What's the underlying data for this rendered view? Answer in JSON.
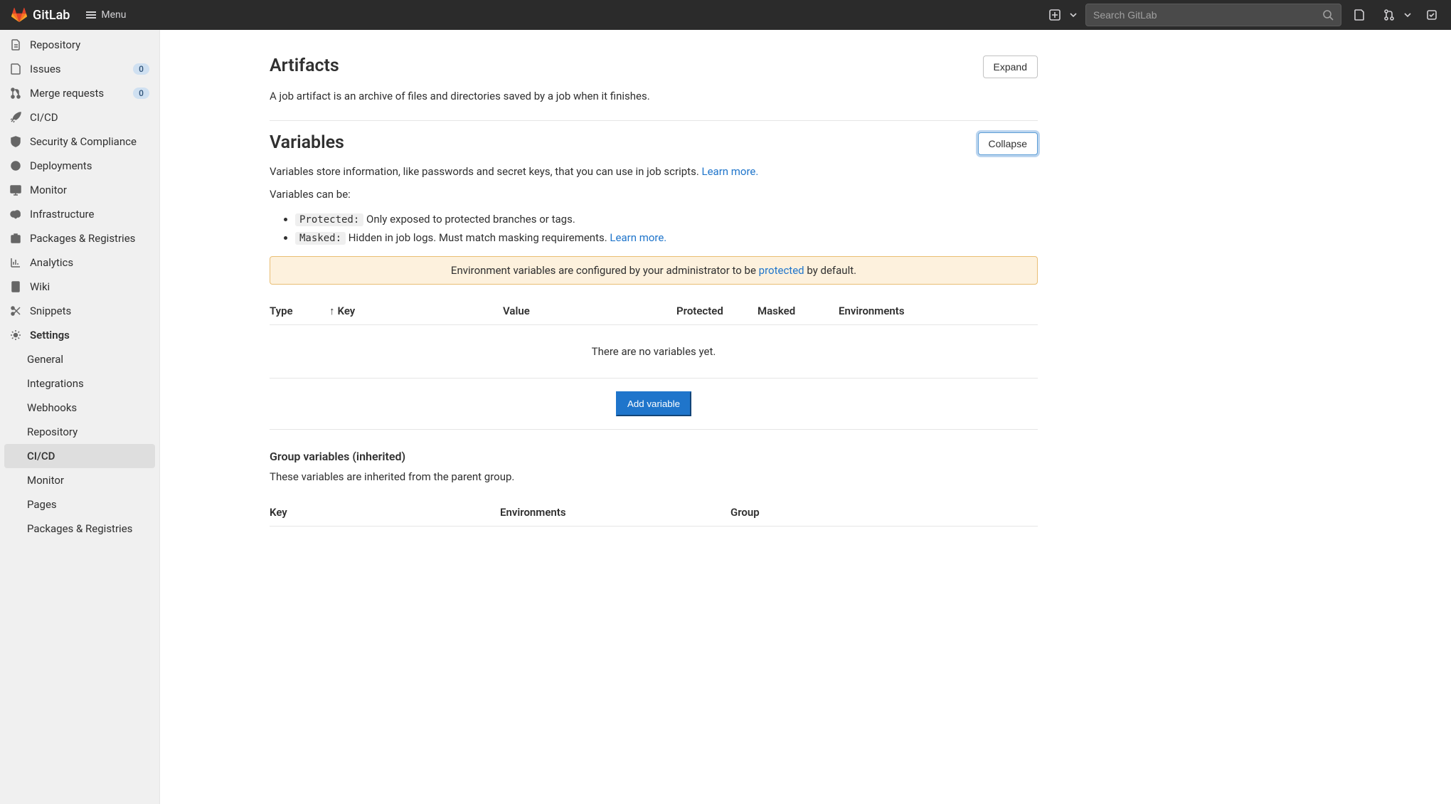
{
  "header": {
    "brand": "GitLab",
    "menu_label": "Menu",
    "search_placeholder": "Search GitLab"
  },
  "sidebar": {
    "items": [
      {
        "label": "Repository",
        "icon": "doc"
      },
      {
        "label": "Issues",
        "icon": "issues",
        "badge": "0"
      },
      {
        "label": "Merge requests",
        "icon": "merge",
        "badge": "0"
      },
      {
        "label": "CI/CD",
        "icon": "rocket"
      },
      {
        "label": "Security & Compliance",
        "icon": "shield"
      },
      {
        "label": "Deployments",
        "icon": "deploy"
      },
      {
        "label": "Monitor",
        "icon": "monitor"
      },
      {
        "label": "Infrastructure",
        "icon": "cloud"
      },
      {
        "label": "Packages & Registries",
        "icon": "package"
      },
      {
        "label": "Analytics",
        "icon": "chart"
      },
      {
        "label": "Wiki",
        "icon": "book"
      },
      {
        "label": "Snippets",
        "icon": "scissors"
      },
      {
        "label": "Settings",
        "icon": "gear",
        "bold": true
      }
    ],
    "sub_items": [
      {
        "label": "General"
      },
      {
        "label": "Integrations"
      },
      {
        "label": "Webhooks"
      },
      {
        "label": "Repository"
      },
      {
        "label": "CI/CD",
        "active": true
      },
      {
        "label": "Monitor"
      },
      {
        "label": "Pages"
      },
      {
        "label": "Packages & Registries"
      }
    ]
  },
  "artifacts": {
    "title": "Artifacts",
    "desc": "A job artifact is an archive of files and directories saved by a job when it finishes.",
    "button": "Expand"
  },
  "variables": {
    "title": "Variables",
    "button": "Collapse",
    "desc_prefix": "Variables store information, like passwords and secret keys, that you can use in job scripts. ",
    "learn_more": "Learn more.",
    "can_be": "Variables can be:",
    "protected_label": "Protected:",
    "protected_desc": " Only exposed to protected branches or tags.",
    "masked_label": "Masked:",
    "masked_desc": " Hidden in job logs. Must match masking requirements. ",
    "alert_prefix": "Environment variables are configured by your administrator to be ",
    "alert_link": "protected",
    "alert_suffix": " by default.",
    "columns": {
      "type": "Type",
      "key": "Key",
      "value": "Value",
      "protected": "Protected",
      "masked": "Masked",
      "envs": "Environments"
    },
    "sort_arrow": "↑",
    "empty": "There are no variables yet.",
    "add_button": "Add variable"
  },
  "group_vars": {
    "title": "Group variables (inherited)",
    "desc": "These variables are inherited from the parent group.",
    "columns": {
      "key": "Key",
      "envs": "Environments",
      "group": "Group"
    }
  }
}
